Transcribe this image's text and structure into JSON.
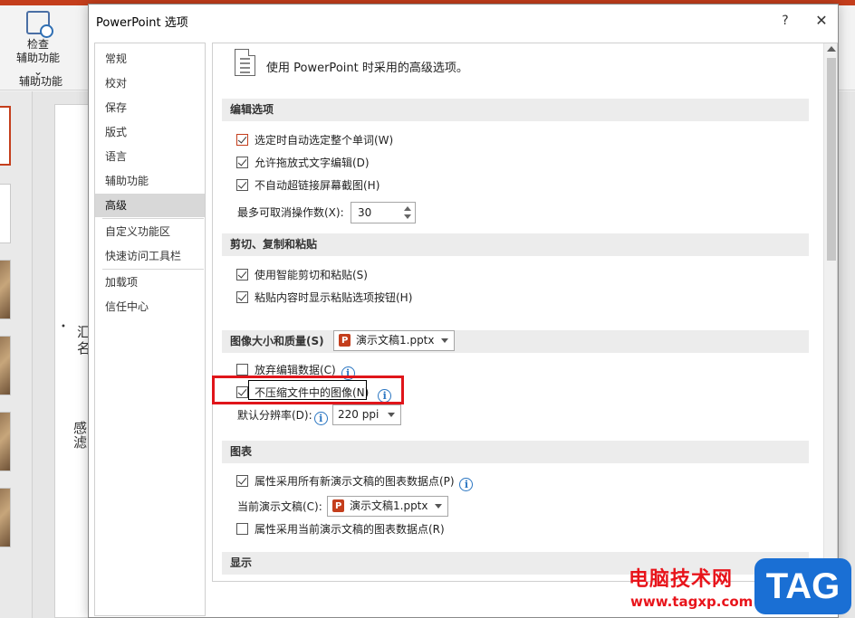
{
  "ribbon": {
    "check_btn_line1": "检查",
    "check_btn_line2": "辅助功能",
    "check_btn_caret": "⌄",
    "group_label": "辅助功能"
  },
  "slide": {
    "text1": "汇",
    "text2": "名",
    "text3": "感",
    "text4": "滤",
    "bullet": "•"
  },
  "dialog": {
    "title": "PowerPoint 选项",
    "help": "?",
    "close": "✕"
  },
  "nav": {
    "items": [
      "常规",
      "校对",
      "保存",
      "版式",
      "语言",
      "辅助功能",
      "高级",
      "自定义功能区",
      "快速访问工具栏",
      "加载项",
      "信任中心"
    ],
    "active": "高级"
  },
  "content": {
    "heading": "使用 PowerPoint 时采用的高级选项。",
    "sections": {
      "edit": {
        "title": "编辑选项",
        "opt1": "选定时自动选定整个单词(W)",
        "opt2": "允许拖放式文字编辑(D)",
        "opt3": "不自动超链接屏幕截图(H)",
        "undo_label": "最多可取消操作数(X):",
        "undo_value": "30"
      },
      "clipboard": {
        "title": "剪切、复制和粘贴",
        "opt1": "使用智能剪切和粘贴(S)",
        "opt2": "粘贴内容时显示粘贴选项按钮(H)"
      },
      "image": {
        "title": "图像大小和质量(S)",
        "file": "演示文稿1.pptx",
        "opt1": "放弃编辑数据(C)",
        "opt2": "不压缩文件中的图像(N)",
        "res_label": "默认分辨率(D):",
        "res_value": "220 ppi"
      },
      "chart": {
        "title": "图表",
        "opt1": "属性采用所有新演示文稿的图表数据点(P)",
        "cur_label": "当前演示文稿(C):",
        "cur_file": "演示文稿1.pptx",
        "opt2": "属性采用当前演示文稿的图表数据点(R)"
      },
      "display": {
        "title": "显示"
      }
    },
    "info_glyph": "i"
  },
  "watermark": {
    "text": "电脑技术网",
    "url": "www.tagxp.com",
    "tag": "TAG"
  }
}
